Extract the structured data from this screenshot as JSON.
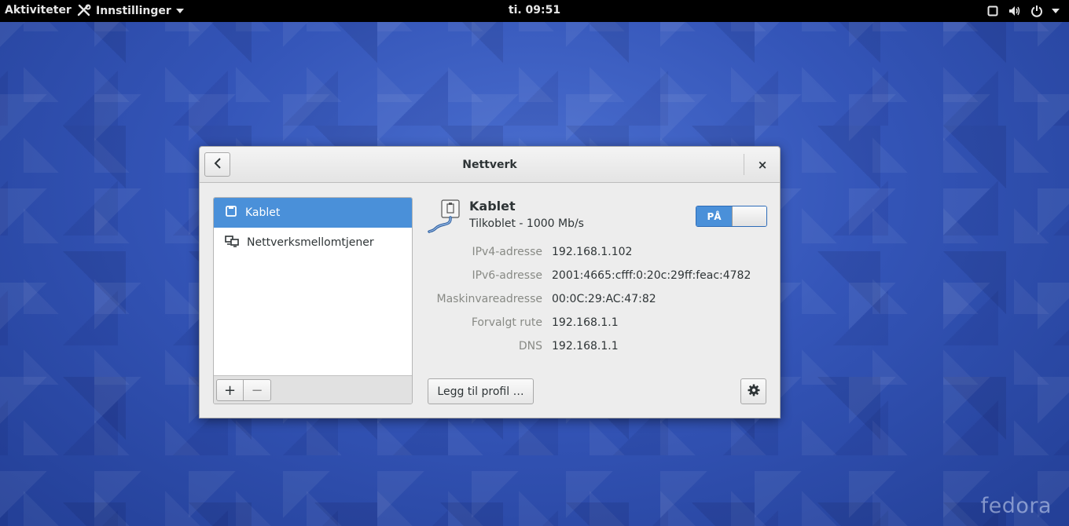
{
  "topbar": {
    "activities": "Aktiviteter",
    "app_menu_label": "Innstillinger",
    "app_menu_icon": "tools-icon",
    "clock": "ti. 09:51",
    "status_icons": [
      "window-icon",
      "volume-icon",
      "power-icon",
      "chevron-down-icon"
    ]
  },
  "window": {
    "title": "Nettverk",
    "back_icon": "chevron-left-icon",
    "close_label": "×"
  },
  "sidebar": {
    "items": [
      {
        "label": "Kablet",
        "icon": "wired-icon",
        "selected": true
      },
      {
        "label": "Nettverksmellomtjener",
        "icon": "proxy-icon",
        "selected": false
      }
    ],
    "add_label": "+",
    "remove_label": "−"
  },
  "device": {
    "name": "Kablet",
    "status": "Tilkoblet - 1000 Mb/s",
    "switch_label": "PÅ",
    "switch_on": true,
    "properties": [
      {
        "label": "IPv4-adresse",
        "value": "192.168.1.102"
      },
      {
        "label": "IPv6-adresse",
        "value": "2001:4665:cfff:0:20c:29ff:feac:4782"
      },
      {
        "label": "Maskinvareadresse",
        "value": "00:0C:29:AC:47:82"
      },
      {
        "label": "Forvalgt rute",
        "value": "192.168.1.1"
      },
      {
        "label": "DNS",
        "value": "192.168.1.1"
      }
    ],
    "add_profile_label": "Legg til profil …",
    "options_icon": "gear-icon"
  },
  "desktop": {
    "logo_text": "fedora"
  },
  "colors": {
    "accent": "#4a90d9",
    "topbar": "#000000",
    "desktop": "#3455b8"
  }
}
